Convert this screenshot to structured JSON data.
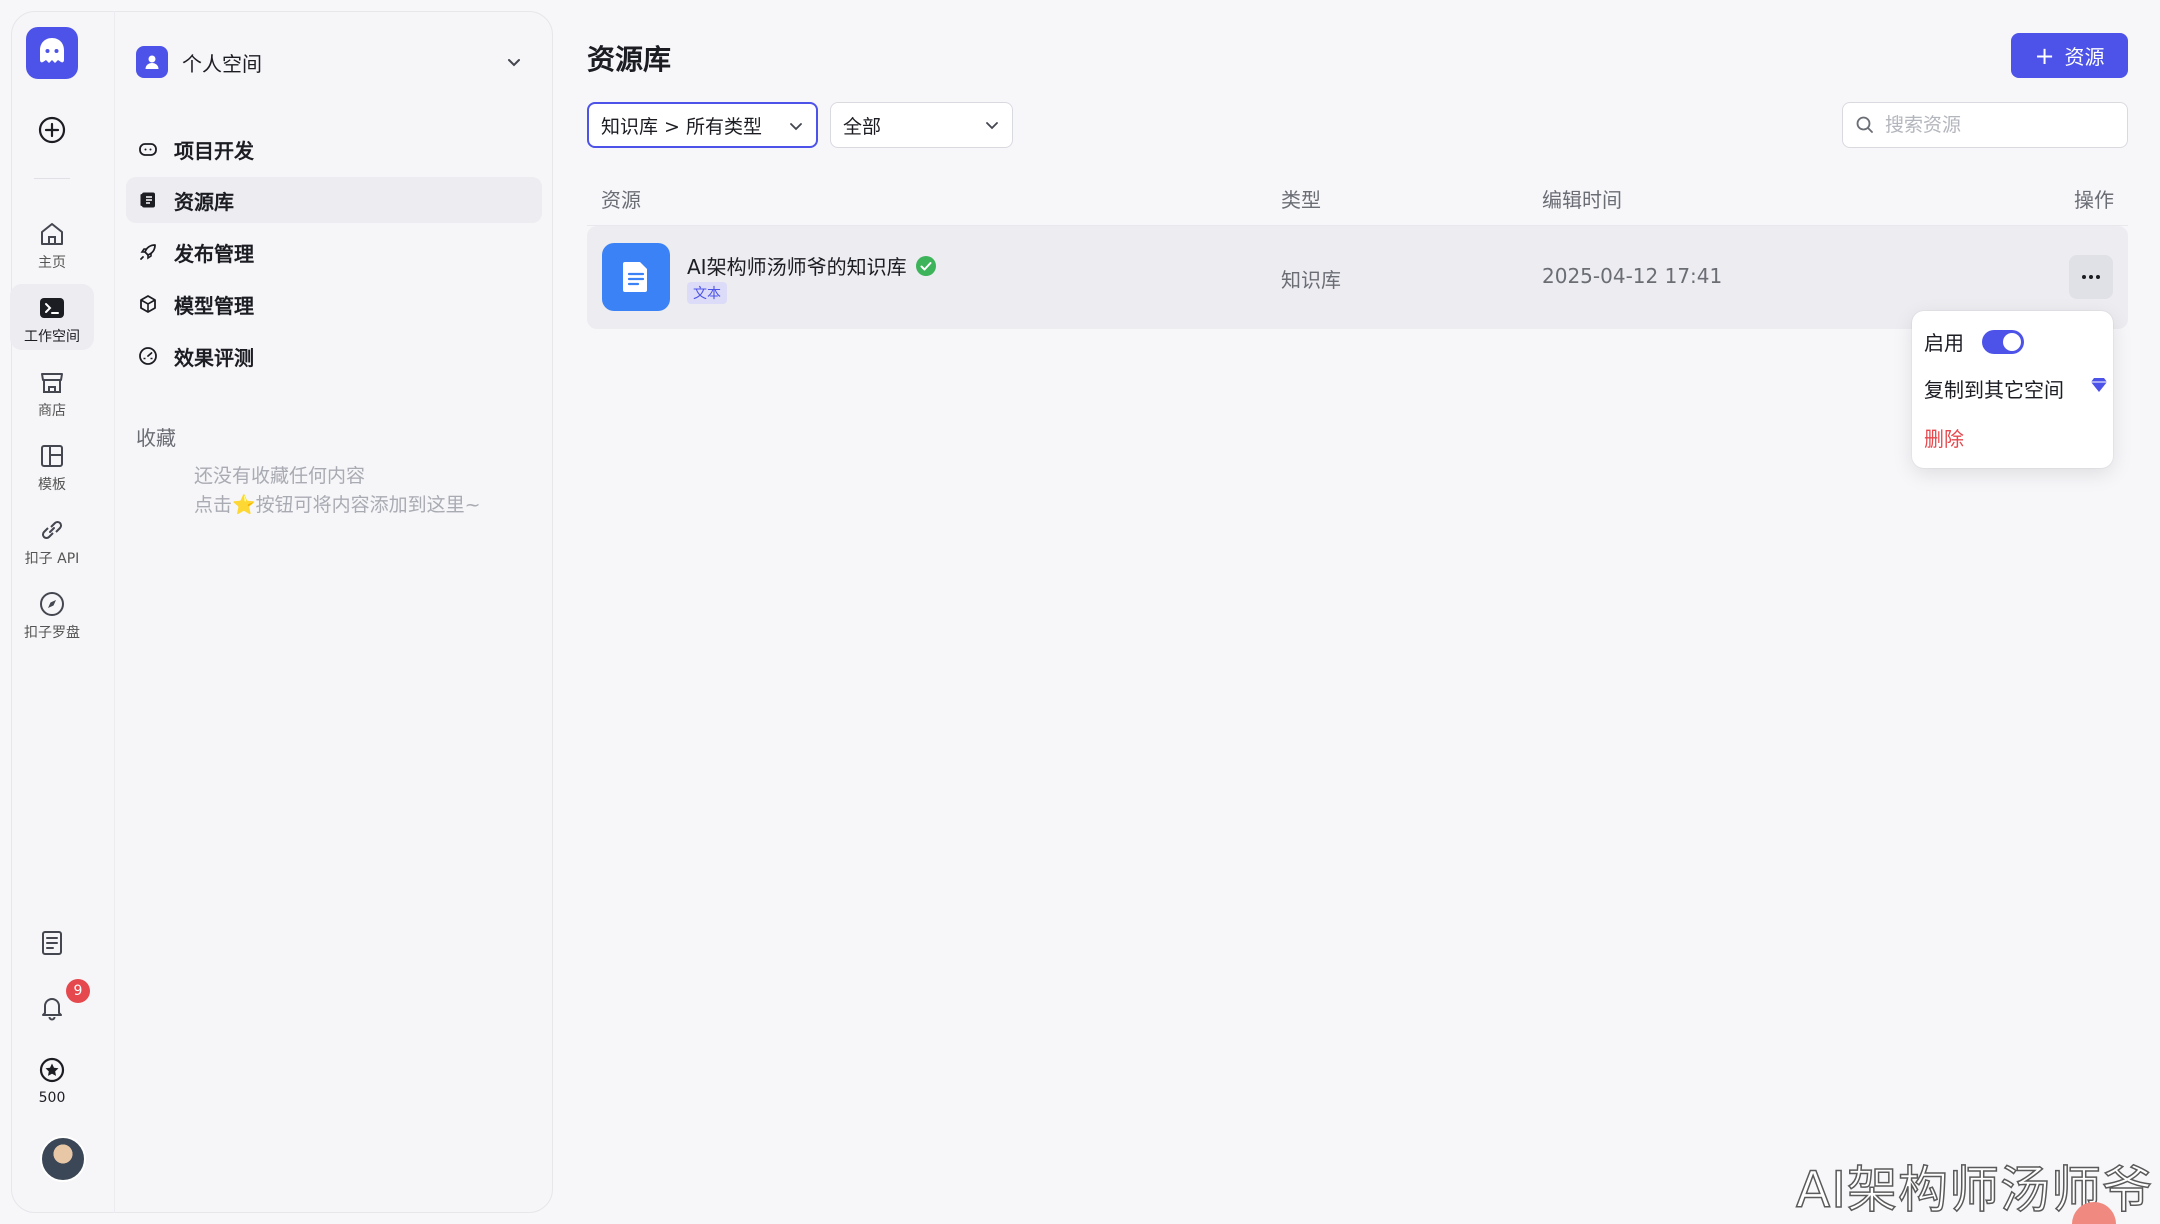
{
  "rail": {
    "items": [
      {
        "label": "主页",
        "icon": "home-icon"
      },
      {
        "label": "工作空间",
        "icon": "terminal-icon"
      },
      {
        "label": "商店",
        "icon": "store-icon"
      },
      {
        "label": "模板",
        "icon": "template-icon"
      },
      {
        "label": "扣子 API",
        "icon": "link-icon"
      },
      {
        "label": "扣子罗盘",
        "icon": "compass-icon"
      }
    ],
    "notification_count": "9",
    "credits": "500"
  },
  "sidebar": {
    "space_name": "个人空间",
    "nav": [
      {
        "label": "项目开发",
        "icon": "gamepad-icon"
      },
      {
        "label": "资源库",
        "icon": "library-icon"
      },
      {
        "label": "发布管理",
        "icon": "rocket-icon"
      },
      {
        "label": "模型管理",
        "icon": "cube-icon"
      },
      {
        "label": "效果评测",
        "icon": "gauge-icon"
      }
    ],
    "favorites_title": "收藏",
    "favorites_empty_line1": "还没有收藏任何内容",
    "favorites_empty_line2": "点击⭐按钮可将内容添加到这里~"
  },
  "main": {
    "title": "资源库",
    "add_button": "资源",
    "filter_type": "知识库 > 所有类型",
    "filter_scope": "全部",
    "search_placeholder": "搜索资源",
    "columns": [
      "资源",
      "类型",
      "编辑时间",
      "操作"
    ],
    "rows": [
      {
        "name": "AI架构师汤师爷的知识库",
        "tag": "文本",
        "type": "知识库",
        "edited": "2025-04-12 17:41"
      }
    ]
  },
  "menu": {
    "enable": "启用",
    "copy": "复制到其它空间",
    "delete": "删除"
  },
  "watermark": "AI架构师汤师爷",
  "colors": {
    "accent": "#4d53e8",
    "danger": "#e5484d",
    "success": "#3db35a"
  }
}
